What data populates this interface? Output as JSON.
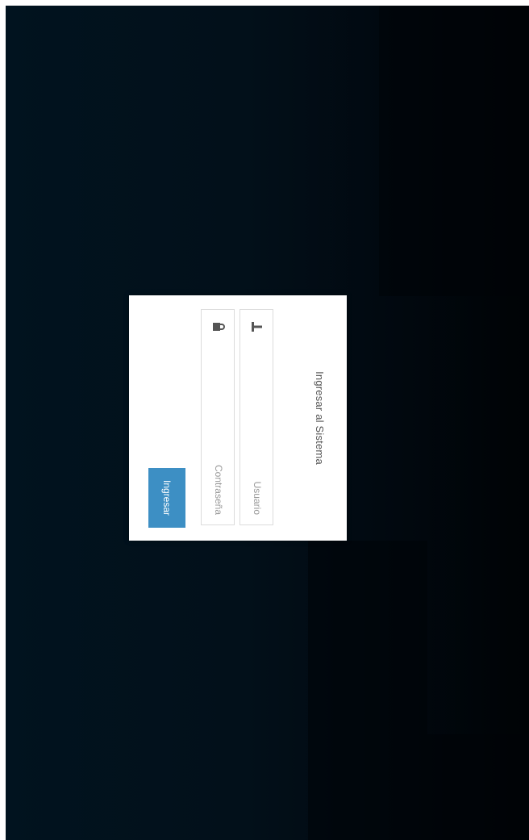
{
  "login": {
    "title": "Ingresar al Sistema",
    "username_placeholder": "Usuario",
    "password_placeholder": "Contraseña",
    "submit_label": "Ingresar",
    "username_icon": "user-icon",
    "password_icon": "lock-icon"
  },
  "colors": {
    "background_dark": "#01131f",
    "card": "#ffffff",
    "button": "#3d8fc4"
  }
}
